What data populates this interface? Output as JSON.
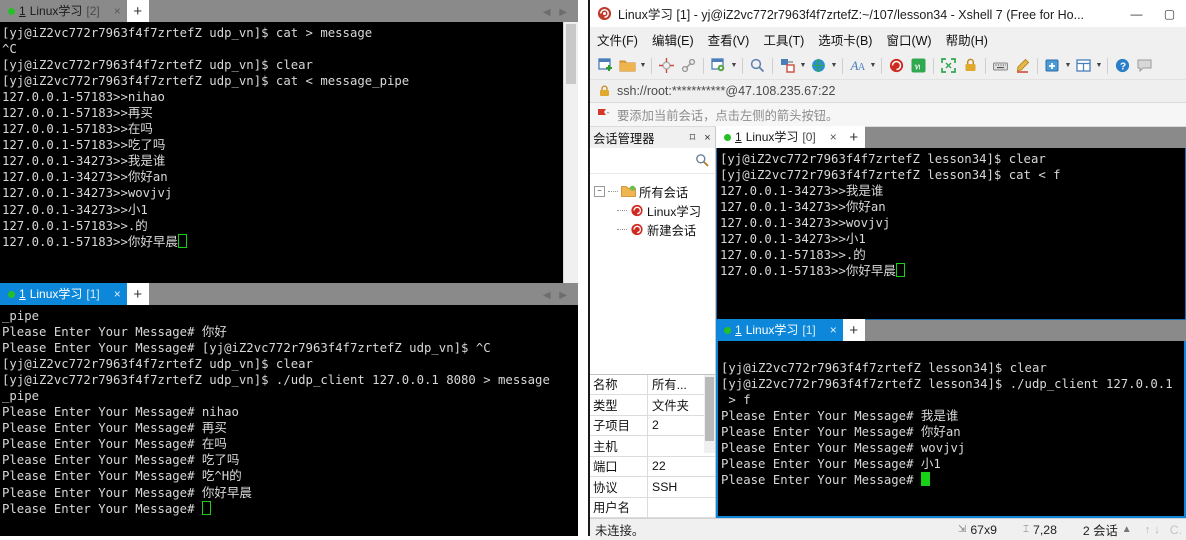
{
  "left_top_pane": {
    "tab": {
      "dot": "green",
      "number": "1",
      "name": "Linux学习",
      "index": "[2]",
      "close": "×",
      "state": "inactive"
    },
    "new_tab_label": "+",
    "nav_arrows": "◀ ▶",
    "terminal_lines": [
      "[yj@iZ2vc772r7963f4f7zrtefZ udp_vn]$ cat > message",
      "^C",
      "[yj@iZ2vc772r7963f4f7zrtefZ udp_vn]$ clear",
      "[yj@iZ2vc772r7963f4f7zrtefZ udp_vn]$ cat < message_pipe",
      "127.0.0.1-57183>>nihao",
      "127.0.0.1-57183>>再买",
      "127.0.0.1-57183>>在吗",
      "127.0.0.1-57183>>吃了吗",
      "127.0.0.1-34273>>我是谁",
      "127.0.0.1-34273>>你好an",
      "127.0.0.1-34273>>wovjvj",
      "127.0.0.1-34273>>小1",
      "127.0.0.1-57183>>.的",
      "127.0.0.1-57183>>你好早晨"
    ]
  },
  "left_bottom_pane": {
    "tab": {
      "dot": "green",
      "number": "1",
      "name": "Linux学习",
      "index": "[1]",
      "close": "×",
      "state": "active"
    },
    "new_tab_label": "+",
    "nav_arrows": "◀ ▶",
    "terminal_lines": [
      "_pipe",
      "Please Enter Your Message# 你好",
      "Please Enter Your Message# [yj@iZ2vc772r7963f4f7zrtefZ udp_vn]$ ^C",
      "[yj@iZ2vc772r7963f4f7zrtefZ udp_vn]$ clear",
      "[yj@iZ2vc772r7963f4f7zrtefZ udp_vn]$ ./udp_client 127.0.0.1 8080 > message",
      "_pipe",
      "Please Enter Your Message# nihao",
      "Please Enter Your Message# 再买",
      "Please Enter Your Message# 在吗",
      "Please Enter Your Message# 吃了吗",
      "Please Enter Your Message# 吃^H的",
      "Please Enter Your Message# 你好早晨",
      "Please Enter Your Message# "
    ]
  },
  "xshell": {
    "title": "Linux学习 [1] - yj@iZ2vc772r7963f4f7zrtefZ:~/107/lesson34 - Xshell 7 (Free for Ho...",
    "window_controls": {
      "minimize": "—",
      "maximize": "▢"
    },
    "menu": [
      "文件(F)",
      "编辑(E)",
      "查看(V)",
      "工具(T)",
      "选项卡(B)",
      "窗口(W)",
      "帮助(H)"
    ],
    "toolbar_icons": [
      "new-session-icon",
      "open-folder-icon",
      "open-folder-dropdown",
      "disconnect-icon",
      "link-icon",
      "session-properties-icon",
      "session-properties-dropdown",
      "find-icon",
      "transfer-file-icon",
      "transfer-file-dropdown",
      "globe-icon",
      "globe-dropdown",
      "font-icon",
      "font-dropdown",
      "xshell-icon",
      "xftp-icon",
      "fullscreen-icon",
      "lock-icon",
      "keyboard-icon",
      "highlight-icon",
      "add-tab-icon",
      "add-tab-dropdown",
      "layout-icon",
      "layout-dropdown",
      "help-icon",
      "chat-icon"
    ],
    "url": "ssh://root:***********@47.108.235.67:22",
    "notice": "要添加当前会话，点击左侧的箭头按钮。",
    "session_manager": {
      "title": "会话管理器",
      "pin": "⌑",
      "close": "×",
      "search_icon": "search-icon",
      "tree": [
        {
          "label": "所有会话",
          "type": "folder",
          "depth": 0,
          "expander": "−"
        },
        {
          "label": "Linux学习",
          "type": "session",
          "depth": 1,
          "expander": ""
        },
        {
          "label": "新建会话",
          "type": "session",
          "depth": 1,
          "expander": ""
        }
      ],
      "properties": [
        {
          "key": "名称",
          "value": "所有..."
        },
        {
          "key": "类型",
          "value": "文件夹"
        },
        {
          "key": "子项目",
          "value": "2"
        },
        {
          "key": "主机",
          "value": ""
        },
        {
          "key": "端口",
          "value": "22"
        },
        {
          "key": "协议",
          "value": "SSH"
        },
        {
          "key": "用户名",
          "value": ""
        }
      ]
    },
    "terminal_top": {
      "tab": {
        "dot": "green",
        "number": "1",
        "name": "Linux学习",
        "index": "[0]",
        "close": "×",
        "state": "active-white"
      },
      "new_tab_label": "+",
      "lines": [
        "[yj@iZ2vc772r7963f4f7zrtefZ lesson34]$ clear",
        "[yj@iZ2vc772r7963f4f7zrtefZ lesson34]$ cat < f",
        "127.0.0.1-34273>>我是谁",
        "127.0.0.1-34273>>你好an",
        "127.0.0.1-34273>>wovjvj",
        "127.0.0.1-34273>>小1",
        "127.0.0.1-57183>>.的",
        "127.0.0.1-57183>>你好早晨"
      ]
    },
    "terminal_bottom": {
      "tab": {
        "dot": "green",
        "number": "1",
        "name": "Linux学习",
        "index": "[1]",
        "close": "×",
        "state": "active-blue"
      },
      "new_tab_label": "+",
      "lines": [
        "",
        "[yj@iZ2vc772r7963f4f7zrtefZ lesson34]$ clear",
        "[yj@iZ2vc772r7963f4f7zrtefZ lesson34]$ ./udp_client 127.0.0.1",
        " > f",
        "Please Enter Your Message# 我是谁",
        "Please Enter Your Message# 你好an",
        "Please Enter Your Message# wovjvj",
        "Please Enter Your Message# 小1",
        "Please Enter Your Message# "
      ]
    },
    "statusbar": {
      "connection": "未连接。",
      "size_icon": "terminal-size-icon",
      "size": "67x9",
      "cursor_icon": "cursor-position-icon",
      "cursor": "7,28",
      "sessions": "2 会话",
      "sessions_caret": "▲",
      "scroll_up": "↑",
      "scroll_down": "↓",
      "caps": "C."
    }
  },
  "colors": {
    "tab_active_blue": "#0d87d9",
    "tab_inactive_gray": "#8a8a8a",
    "terminal_bg": "#000000",
    "terminal_fg": "#d8d8d8",
    "cursor_green": "#17d017",
    "window_chrome": "#f0f0f0"
  }
}
